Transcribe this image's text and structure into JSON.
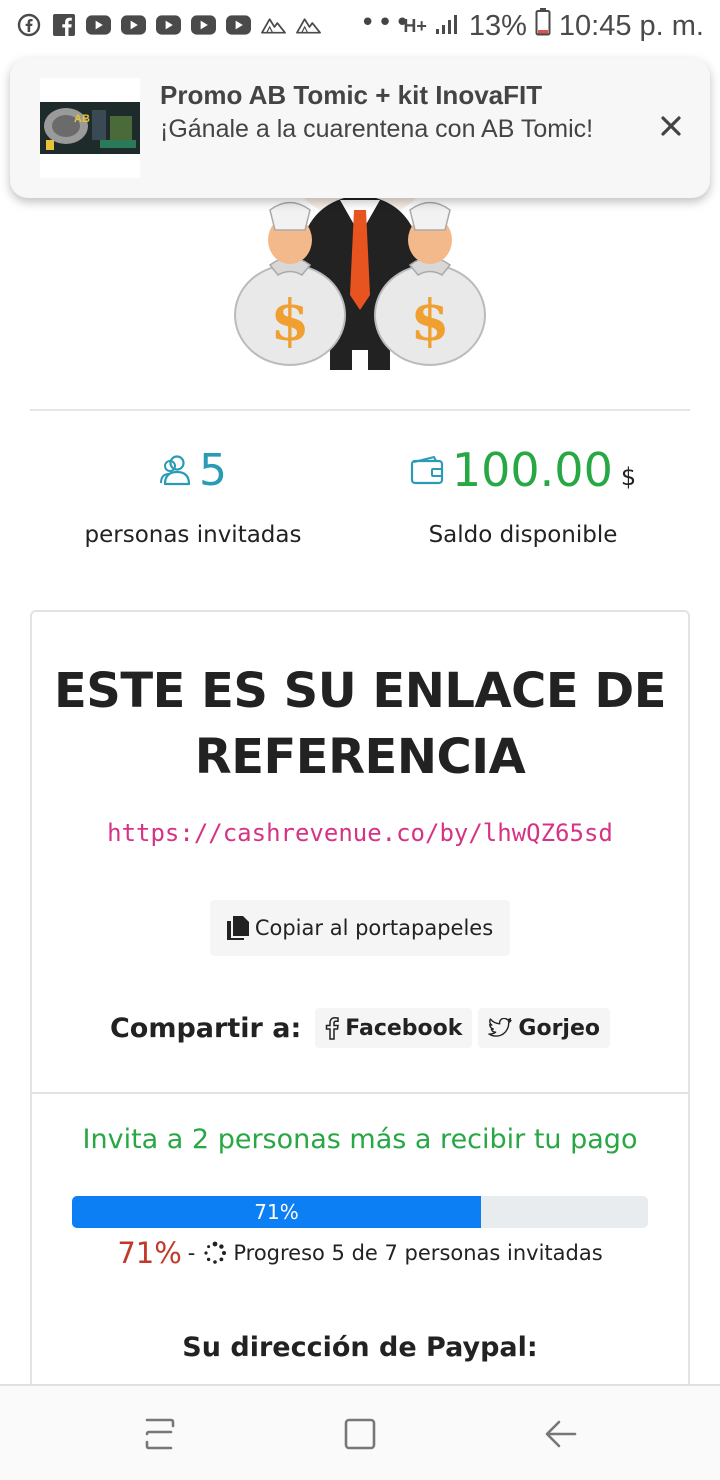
{
  "status_bar": {
    "notification_icons": [
      "facebook-circle-icon",
      "facebook-square-icon",
      "youtube-icon",
      "youtube-icon",
      "youtube-icon",
      "youtube-icon",
      "youtube-icon",
      "mountain-icon",
      "mountain-icon"
    ],
    "more": "•••",
    "network": "H+",
    "battery": "13%",
    "time": "10:45 p. m."
  },
  "notification": {
    "title": "Promo AB Tomic + kit InovaFIT",
    "body": "¡Gánale a la cuarentena con AB Tomic!",
    "thumb_text": "AB",
    "close_icon": "close-icon"
  },
  "stats": {
    "invited_count": "5",
    "invited_label": "personas invitadas",
    "balance_amount": "100.00",
    "balance_currency": "$",
    "balance_label": "Saldo disponible"
  },
  "referral": {
    "title": "ESTE ES SU ENLACE DE REFERENCIA",
    "link": "https://cashrevenue.co/by/lhwQZ65sd",
    "copy_label": "Copiar al portapapeles",
    "share_label": "Compartir a:",
    "share_facebook": "Facebook",
    "share_twitter": "Gorjeo"
  },
  "progress": {
    "message": "Invita a 2 personas más a recibir tu pago",
    "value": 0.71,
    "bar_label": "71%",
    "percent_text": "71%",
    "dash": "-",
    "detail": "Progreso 5 de 7 personas invitadas"
  },
  "paypal": {
    "label": "Su dirección de Paypal:"
  },
  "colors": {
    "accent_green": "#28a745",
    "progress_blue": "#0d7ff5",
    "link_pink": "#d63384",
    "teal": "#2a9bb5",
    "percent_red": "#c0392b"
  }
}
